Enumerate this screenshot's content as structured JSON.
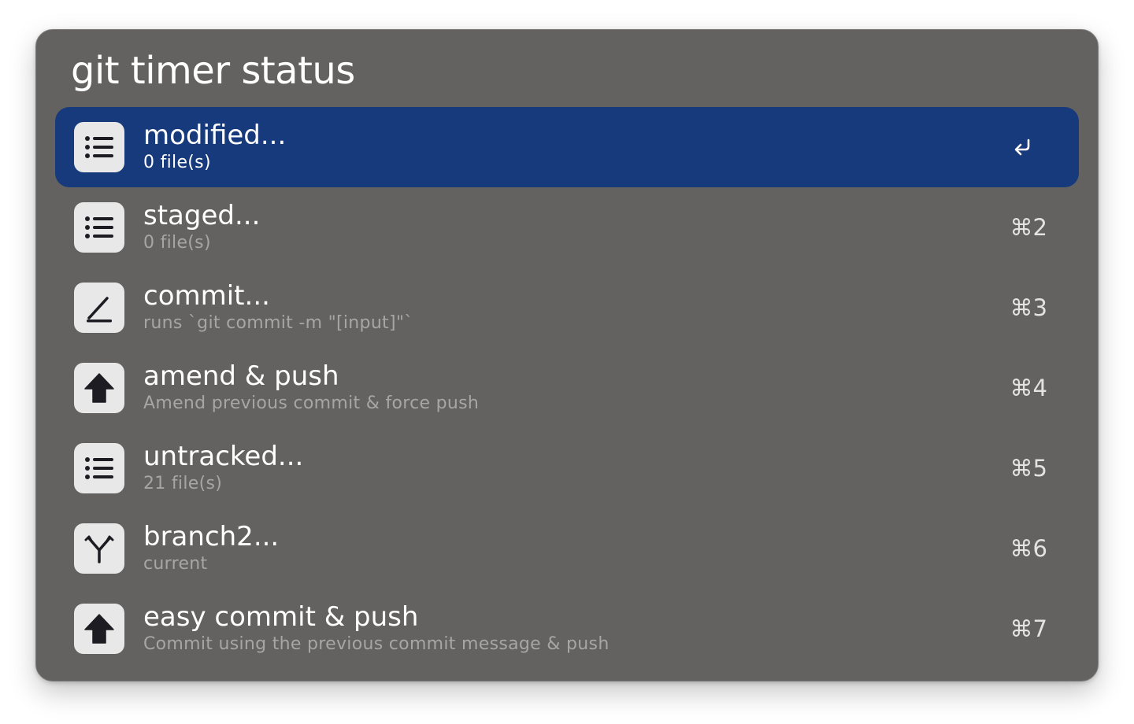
{
  "search": {
    "query": "git timer status"
  },
  "results": [
    {
      "title": "modified...",
      "subtitle": "0 file(s)",
      "shortcut": "",
      "icon": "list-icon",
      "selected": true
    },
    {
      "title": "staged...",
      "subtitle": "0 file(s)",
      "shortcut": "⌘2",
      "icon": "list-icon",
      "selected": false
    },
    {
      "title": "commit...",
      "subtitle": "runs `git commit -m \"[input]\"`",
      "shortcut": "⌘3",
      "icon": "pencil-icon",
      "selected": false
    },
    {
      "title": "amend & push",
      "subtitle": "Amend previous commit & force push",
      "shortcut": "⌘4",
      "icon": "arrow-up-icon",
      "selected": false
    },
    {
      "title": "untracked...",
      "subtitle": "21 file(s)",
      "shortcut": "⌘5",
      "icon": "list-icon",
      "selected": false
    },
    {
      "title": "branch2...",
      "subtitle": "current",
      "shortcut": "⌘6",
      "icon": "branch-icon",
      "selected": false
    },
    {
      "title": "easy commit & push",
      "subtitle": "Commit using the previous commit message & push",
      "shortcut": "⌘7",
      "icon": "arrow-up-icon",
      "selected": false
    }
  ],
  "colors": {
    "window_background": "#636260",
    "selection": "#163a7b",
    "icon_tile": "#e8e8e8",
    "subtitle_text": "#a7a6a3"
  }
}
